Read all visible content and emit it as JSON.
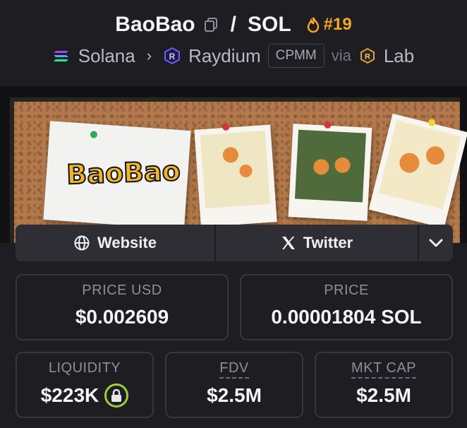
{
  "header": {
    "token_name": "BaoBao",
    "separator": "/",
    "quote": "SOL",
    "rank": "#19",
    "chain": "Solana",
    "dex": "Raydium",
    "pool_type": "CPMM",
    "via": "via",
    "launchpad": "Lab"
  },
  "banner": {
    "logo_text": "BaoBao"
  },
  "social": {
    "website_label": "Website",
    "twitter_label": "Twitter"
  },
  "stats": {
    "price_usd_label": "PRICE USD",
    "price_usd_value": "$0.002609",
    "price_label": "PRICE",
    "price_value": "0.00001804 SOL",
    "liquidity_label": "LIQUIDITY",
    "liquidity_value": "$223K",
    "fdv_label": "FDV",
    "fdv_value": "$2.5M",
    "mkt_cap_label": "MKT CAP",
    "mkt_cap_value": "$2.5M"
  },
  "colors": {
    "rank": "#f5a623",
    "lock_ring": "#9bd03b",
    "background": "#1d1d22"
  }
}
